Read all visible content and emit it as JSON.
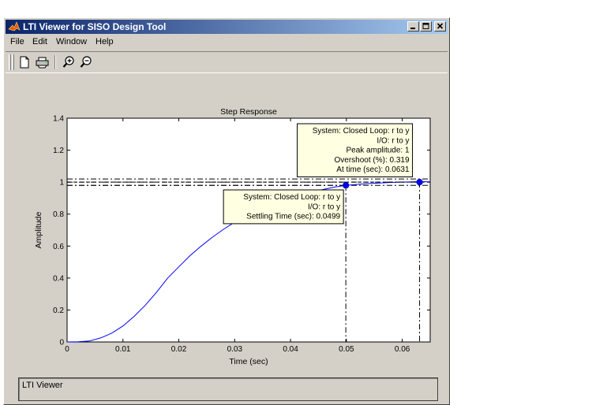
{
  "window": {
    "title": "LTI Viewer for SISO Design Tool",
    "minimize_glyph": "_",
    "maximize_glyph": "□",
    "close_glyph": "×"
  },
  "menu": {
    "items": [
      "File",
      "Edit",
      "Window",
      "Help"
    ]
  },
  "toolbar": {
    "icons": [
      "new-document-icon",
      "print-icon",
      "zoom-in-icon",
      "zoom-out-icon"
    ]
  },
  "chart_data": {
    "type": "line",
    "title": "Step Response",
    "xlabel": "Time (sec)",
    "ylabel": "Amplitude",
    "xlim": [
      0,
      0.065
    ],
    "ylim": [
      0,
      1.4
    ],
    "xticks": [
      0,
      0.01,
      0.02,
      0.03,
      0.04,
      0.05,
      0.06
    ],
    "xtick_labels": [
      "0",
      "0.01",
      "0.02",
      "0.03",
      "0.04",
      "0.05",
      "0.06"
    ],
    "yticks": [
      0,
      0.2,
      0.4,
      0.6,
      0.8,
      1,
      1.2,
      1.4
    ],
    "ytick_labels": [
      "0",
      "0.2",
      "0.4",
      "0.6",
      "0.8",
      "1",
      "1.2",
      "1.4"
    ],
    "grid": false,
    "series": [
      {
        "color": "#0000ff",
        "x": [
          0,
          0.002,
          0.004,
          0.006,
          0.008,
          0.01,
          0.012,
          0.014,
          0.016,
          0.018,
          0.02,
          0.022,
          0.024,
          0.026,
          0.028,
          0.03,
          0.032,
          0.034,
          0.036,
          0.038,
          0.04,
          0.042,
          0.044,
          0.046,
          0.048,
          0.0499,
          0.052,
          0.054,
          0.056,
          0.058,
          0.06,
          0.0631,
          0.065
        ],
        "y": [
          0,
          0.001,
          0.006,
          0.025,
          0.055,
          0.1,
          0.16,
          0.23,
          0.31,
          0.4,
          0.47,
          0.54,
          0.6,
          0.655,
          0.705,
          0.75,
          0.79,
          0.83,
          0.86,
          0.885,
          0.905,
          0.925,
          0.94,
          0.955,
          0.97,
          0.98,
          0.986,
          0.991,
          0.995,
          0.998,
          1.0,
          1.00319,
          1.002
        ]
      }
    ],
    "settling_bounds": [
      0.98,
      1.02
    ],
    "markers": [
      {
        "name": "settling",
        "x": 0.0499,
        "y": 0.98,
        "lines": [
          "System: Closed Loop: r to y",
          "I/O: r to y",
          "Settling Time (sec): 0.0499"
        ]
      },
      {
        "name": "peak",
        "x": 0.0631,
        "y": 1.0,
        "lines": [
          "System: Closed Loop: r to y",
          "I/O: r to y",
          "Peak amplitude: 1",
          "Overshoot (%): 0.319",
          "At time (sec): 0.0631"
        ]
      }
    ],
    "colors": {
      "curve": "#0000ff",
      "marker": "#0000ff",
      "tooltip_bg": "#ffffe1"
    }
  },
  "status": {
    "text": "LTI Viewer"
  }
}
